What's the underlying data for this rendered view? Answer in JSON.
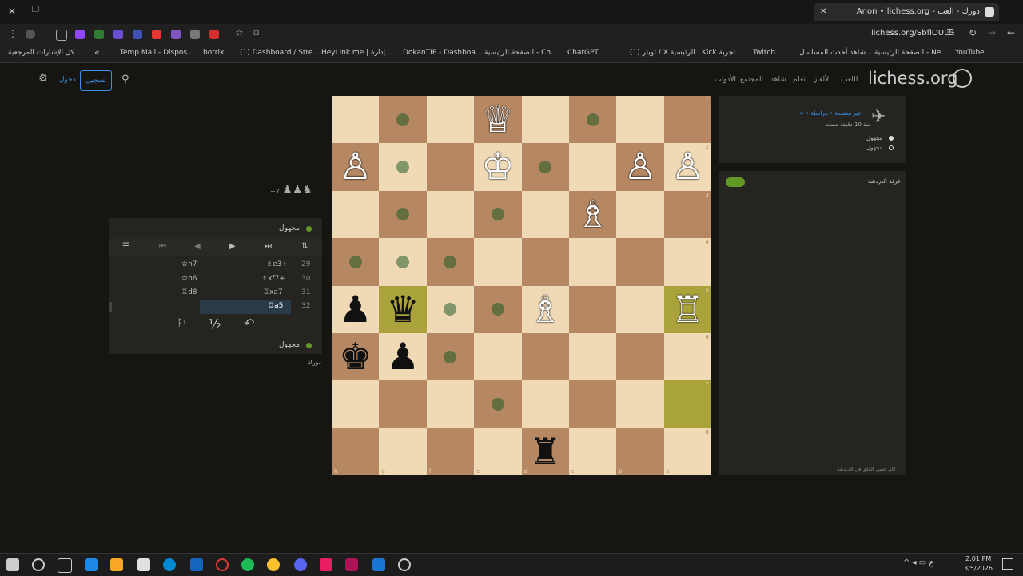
{
  "browser": {
    "tab_title": "Anon • lichess.org - دورك - العب",
    "url": "lichess.org/SbflOULG",
    "bookmarks": [
      "YouTube",
      "الصفحة الرئيسية - Ne...",
      "شاهد أحدث المسلسل...",
      "Twitch",
      "Kick تجربة",
      "(1) تويتر / X الرئيسية",
      "ChatGPT",
      "الصفحة الرئيسية - Ch...",
      "DokanTIP - Dashboa...",
      "HeyLink.me | إدارة...",
      "(1) Dashboard / Stre...",
      "botrix",
      "Temp Mail - Dispos...",
      "كل الإشارات المرجعية"
    ]
  },
  "site": {
    "logo": "lichess.org",
    "nav": [
      "تعلم",
      "شاهد",
      "المجتمع",
      "الأدوات",
      "اللعب",
      "الألغاز"
    ],
    "signin": "تسجيل",
    "login": "دخول"
  },
  "game": {
    "top_player": "مجهول",
    "bottom_player": "مجهول",
    "material_diff": "+7",
    "your_turn": "دورك",
    "moves": [
      {
        "num": "29",
        "white": "♗e3+",
        "black": "♔h7"
      },
      {
        "num": "30",
        "white": "♗xf7+",
        "black": "♔h6"
      },
      {
        "num": "31",
        "white": "♖xa7",
        "black": "♖d8"
      },
      {
        "num": "32",
        "white": "♖a5",
        "black": ""
      }
    ],
    "controls": {
      "draw": "½"
    }
  },
  "right_panel": {
    "challenge_line1": "∞ • غير معتمدة • مراسلة",
    "challenge_line2": "منذ 10 دقيقة مضت",
    "players": [
      "مجهول",
      "مجهول"
    ],
    "chat_title": "غرفة الدردشة",
    "chat_placeholder": "كن حسن الخلق في الدردشة!"
  },
  "board": {
    "files": [
      "h",
      "g",
      "f",
      "e",
      "d",
      "c",
      "b",
      "a"
    ],
    "ranks": [
      "1",
      "2",
      "3",
      "4",
      "5",
      "6",
      "7",
      "8"
    ],
    "pieces": [
      {
        "square": "e1",
        "piece": "♕",
        "color": "w"
      },
      {
        "square": "h2",
        "piece": "♙",
        "color": "w"
      },
      {
        "square": "e2",
        "piece": "♔",
        "color": "w"
      },
      {
        "square": "b2",
        "piece": "♙",
        "color": "w"
      },
      {
        "square": "a2",
        "piece": "♙",
        "color": "w"
      },
      {
        "square": "c3",
        "piece": "♗",
        "color": "w"
      },
      {
        "square": "h5",
        "piece": "♟",
        "color": "b"
      },
      {
        "square": "g5",
        "piece": "♛",
        "color": "b"
      },
      {
        "square": "d5",
        "piece": "♗",
        "color": "w"
      },
      {
        "square": "a5",
        "piece": "♖",
        "color": "w"
      },
      {
        "square": "h6",
        "piece": "♚",
        "color": "b"
      },
      {
        "square": "g6",
        "piece": "♟",
        "color": "b"
      },
      {
        "square": "d8",
        "piece": "♜",
        "color": "b"
      }
    ],
    "dots": [
      "g1",
      "c1",
      "g2",
      "d2",
      "g3",
      "e3",
      "h4",
      "g4",
      "f4",
      "f5",
      "e5",
      "f6",
      "e7"
    ],
    "highlight": [
      "g5",
      "a5",
      "a7"
    ],
    "colors": {
      "light": "#f0d9b5",
      "dark": "#b58863",
      "highlight": "#aaa23a"
    }
  },
  "taskbar": {
    "time": "2:01 PM",
    "date": "3/5/2026"
  }
}
